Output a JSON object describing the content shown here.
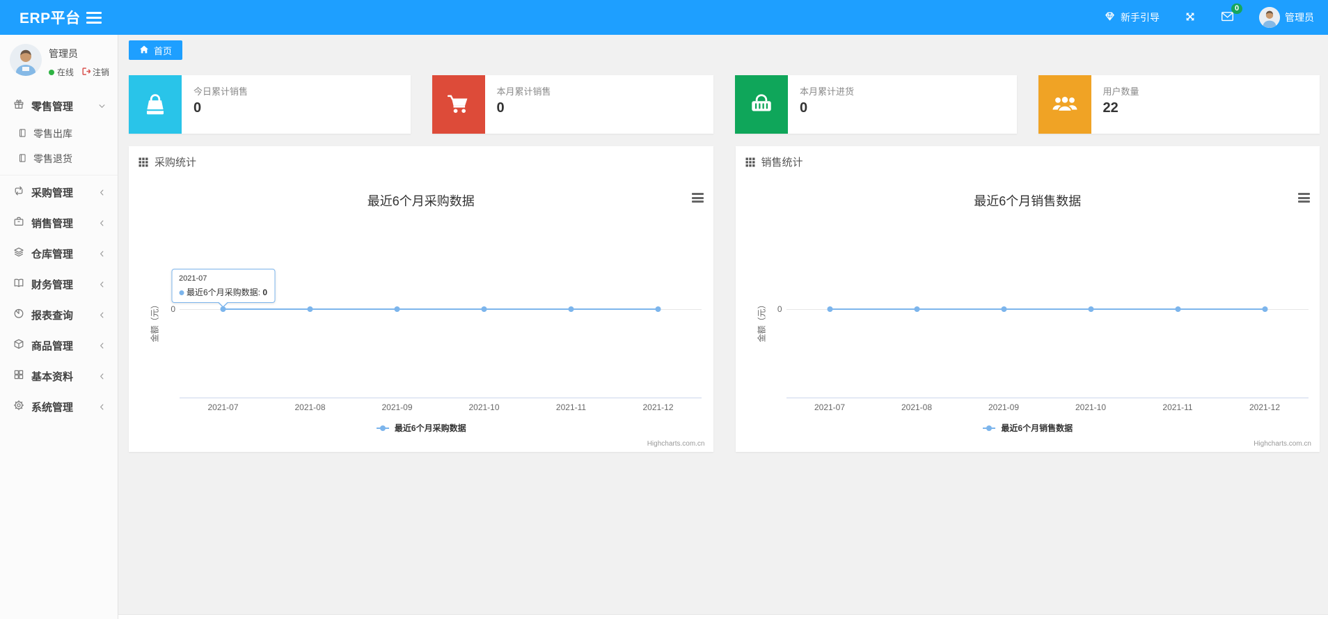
{
  "topbar": {
    "logo": "ERP平台",
    "guide_label": "新手引导",
    "mail_badge": "0",
    "user_name": "管理员"
  },
  "sidebar": {
    "user": {
      "name": "管理员",
      "status_label": "在线",
      "logout_label": "注销"
    },
    "menu": [
      {
        "id": "retail",
        "label": "零售管理",
        "icon": "gift-icon",
        "state": "expanded",
        "children": [
          {
            "label": "零售出库",
            "icon": "doc-icon"
          },
          {
            "label": "零售退货",
            "icon": "doc-icon"
          }
        ]
      },
      {
        "id": "purchase",
        "label": "采购管理",
        "icon": "repeat-icon",
        "state": "collapsed"
      },
      {
        "id": "sales",
        "label": "销售管理",
        "icon": "briefcase-icon",
        "state": "collapsed"
      },
      {
        "id": "warehouse",
        "label": "仓库管理",
        "icon": "layers-icon",
        "state": "collapsed"
      },
      {
        "id": "finance",
        "label": "财务管理",
        "icon": "book-icon",
        "state": "collapsed"
      },
      {
        "id": "report",
        "label": "报表查询",
        "icon": "pie-icon",
        "state": "collapsed"
      },
      {
        "id": "goods",
        "label": "商品管理",
        "icon": "box-icon",
        "state": "collapsed"
      },
      {
        "id": "basic",
        "label": "基本资料",
        "icon": "grid-icon",
        "state": "collapsed"
      },
      {
        "id": "system",
        "label": "系统管理",
        "icon": "gear-icon",
        "state": "collapsed"
      }
    ]
  },
  "tabs": {
    "home": "首页"
  },
  "stats": [
    {
      "label": "今日累计销售",
      "value": "0",
      "color": "#29c4e9",
      "icon": "bag-icon"
    },
    {
      "label": "本月累计销售",
      "value": "0",
      "color": "#dd4b39",
      "icon": "cart-icon"
    },
    {
      "label": "本月累计进货",
      "value": "0",
      "color": "#0fa65a",
      "icon": "basket-icon"
    },
    {
      "label": "用户数量",
      "value": "22",
      "color": "#f0a325",
      "icon": "users-icon"
    }
  ],
  "panels": [
    {
      "title": "采购统计",
      "icon": "th-grid-icon"
    },
    {
      "title": "销售统计",
      "icon": "th-grid-icon"
    }
  ],
  "chart_data": [
    {
      "type": "line",
      "title": "最近6个月采购数据",
      "categories": [
        "2021-07",
        "2021-08",
        "2021-09",
        "2021-10",
        "2021-11",
        "2021-12"
      ],
      "series": [
        {
          "name": "最近6个月采购数据",
          "values": [
            0,
            0,
            0,
            0,
            0,
            0
          ]
        }
      ],
      "ylabel": "金额（元）",
      "yticks": [
        "0"
      ],
      "line_color": "#7cb5ec",
      "legend_position": "bottom-center",
      "grid": "zero-line-only",
      "credits": "Highcharts.com.cn",
      "tooltip": {
        "header": "2021-07",
        "series": "最近6个月采购数据",
        "value": "0",
        "point_index": 0
      }
    },
    {
      "type": "line",
      "title": "最近6个月销售数据",
      "categories": [
        "2021-07",
        "2021-08",
        "2021-09",
        "2021-10",
        "2021-11",
        "2021-12"
      ],
      "series": [
        {
          "name": "最近6个月销售数据",
          "values": [
            0,
            0,
            0,
            0,
            0,
            0
          ]
        }
      ],
      "ylabel": "金额（元）",
      "yticks": [
        "0"
      ],
      "line_color": "#7cb5ec",
      "legend_position": "bottom-center",
      "grid": "zero-line-only",
      "credits": "Highcharts.com.cn",
      "tooltip": null
    }
  ]
}
